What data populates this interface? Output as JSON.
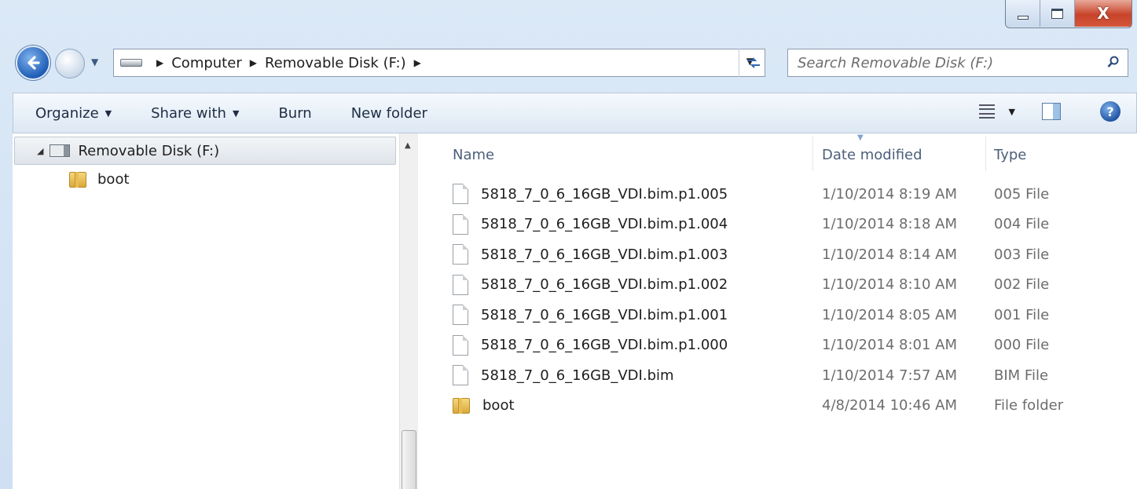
{
  "window": {
    "controls": {
      "close_glyph": "X"
    }
  },
  "address_bar": {
    "breadcrumbs": [
      "Computer",
      "Removable Disk (F:)"
    ],
    "search_placeholder": "Search Removable Disk (F:)"
  },
  "toolbar": {
    "organize": "Organize",
    "share_with": "Share with",
    "burn": "Burn",
    "new_folder": "New folder"
  },
  "nav_pane": {
    "root": "Removable Disk (F:)",
    "children": [
      "boot"
    ]
  },
  "file_list": {
    "columns": {
      "name": "Name",
      "date": "Date modified",
      "type": "Type"
    },
    "rows": [
      {
        "name": "5818_7_0_6_16GB_VDI.bim.p1.005",
        "date": "1/10/2014 8:19 AM",
        "type": "005 File",
        "icon": "file-icon"
      },
      {
        "name": "5818_7_0_6_16GB_VDI.bim.p1.004",
        "date": "1/10/2014 8:18 AM",
        "type": "004 File",
        "icon": "file-icon"
      },
      {
        "name": "5818_7_0_6_16GB_VDI.bim.p1.003",
        "date": "1/10/2014 8:14 AM",
        "type": "003 File",
        "icon": "file-icon"
      },
      {
        "name": "5818_7_0_6_16GB_VDI.bim.p1.002",
        "date": "1/10/2014 8:10 AM",
        "type": "002 File",
        "icon": "file-icon"
      },
      {
        "name": "5818_7_0_6_16GB_VDI.bim.p1.001",
        "date": "1/10/2014 8:05 AM",
        "type": "001 File",
        "icon": "file-icon"
      },
      {
        "name": "5818_7_0_6_16GB_VDI.bim.p1.000",
        "date": "1/10/2014 8:01 AM",
        "type": "000 File",
        "icon": "file-icon"
      },
      {
        "name": "5818_7_0_6_16GB_VDI.bim",
        "date": "1/10/2014 7:57 AM",
        "type": "BIM File",
        "icon": "file-icon"
      },
      {
        "name": "boot",
        "date": "4/8/2014 10:46 AM",
        "type": "File folder",
        "icon": "folder-icon"
      }
    ]
  }
}
